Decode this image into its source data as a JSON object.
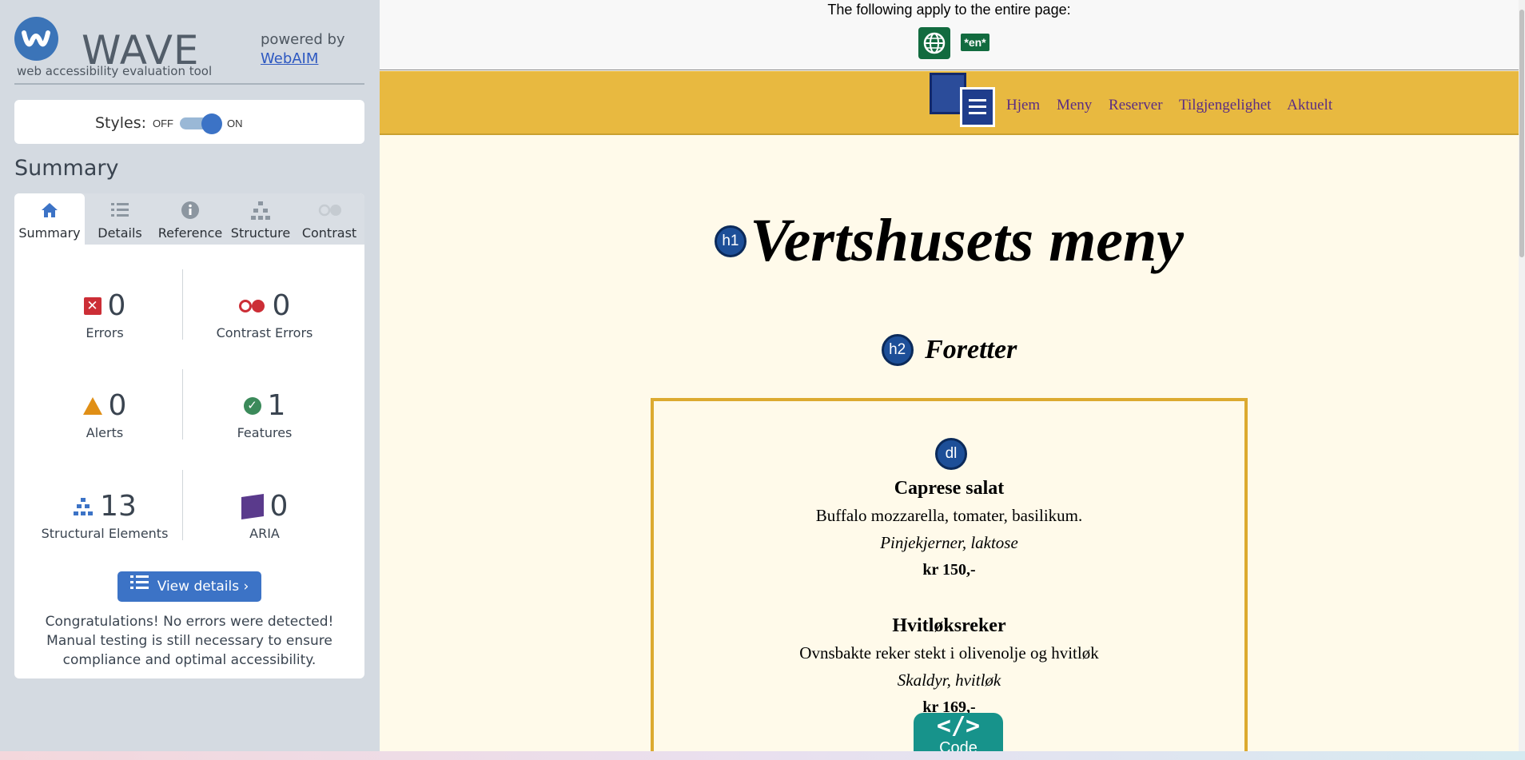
{
  "wave": {
    "logo_text": "WAVE",
    "subtitle": "web accessibility evaluation tool",
    "powered_by": "powered by",
    "powered_link": "WebAIM",
    "styles_label": "Styles:",
    "toggle_off": "OFF",
    "toggle_on": "ON",
    "summary_title": "Summary",
    "tabs": [
      {
        "label": "Summary",
        "icon": "home-icon"
      },
      {
        "label": "Details",
        "icon": "list-icon"
      },
      {
        "label": "Reference",
        "icon": "info-icon"
      },
      {
        "label": "Structure",
        "icon": "structure-icon"
      },
      {
        "label": "Contrast",
        "icon": "contrast-icon"
      }
    ],
    "stats": {
      "errors": {
        "value": "0",
        "label": "Errors"
      },
      "contrast_errors": {
        "value": "0",
        "label": "Contrast Errors"
      },
      "alerts": {
        "value": "0",
        "label": "Alerts"
      },
      "features": {
        "value": "1",
        "label": "Features"
      },
      "structural": {
        "value": "13",
        "label": "Structural Elements"
      },
      "aria": {
        "value": "0",
        "label": "ARIA"
      }
    },
    "view_details": "View details ›",
    "congrats": "Congratulations! No errors were detected! Manual testing is still necessary to ensure compliance and optimal accessibility."
  },
  "page": {
    "top_notice": "The following apply to the entire page:",
    "lang_badge": "*en*",
    "nav": [
      "Hjem",
      "Meny",
      "Reserver",
      "Tilgjengelighet",
      "Aktuelt"
    ],
    "h1_badge": "h1",
    "h1": "Vertshusets meny",
    "h2_badge": "h2",
    "h2": "Foretter",
    "dl_badge": "dl",
    "items": [
      {
        "name": "Caprese salat",
        "desc": "Buffalo mozzarella, tomater, basilikum.",
        "allergen": "Pinjekjerner, laktose",
        "price": "kr 150,-"
      },
      {
        "name": "Hvitløksreker",
        "desc": "Ovnsbakte reker stekt i olivenolje og hvitløk",
        "allergen": "Skaldyr, hvitløk",
        "price": "kr 169,-"
      }
    ],
    "code_label": "Code",
    "code_icon": "</>"
  },
  "colors": {
    "wave_blue": "#3c73c6",
    "page_bg": "#fffaea",
    "nav_bg": "#e8b940",
    "nav_link": "#5b2d83",
    "box_border": "#dcaa30",
    "code_bg": "#17938b"
  }
}
